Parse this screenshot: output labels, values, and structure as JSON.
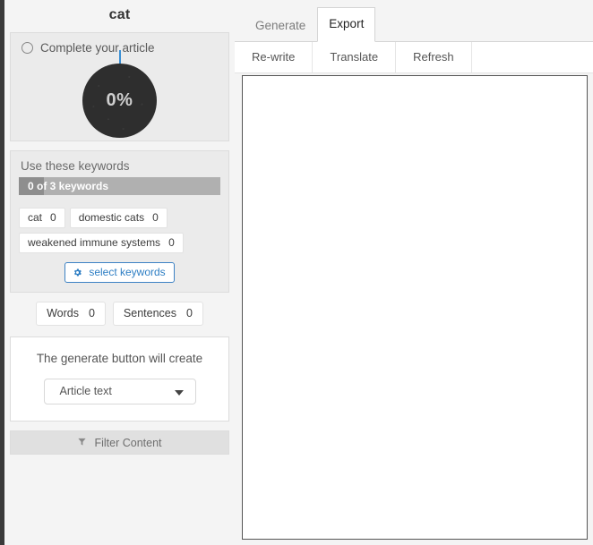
{
  "left": {
    "doc_title": "cat",
    "progress": {
      "status_label": "Complete your article",
      "percent_label": "0%",
      "percent_value": 0,
      "tick_color": "#3a8fd4",
      "donut_color": "#2e2e2e"
    },
    "keywords": {
      "heading": "Use these keywords",
      "progress_label": "0 of 3 keywords",
      "used": 0,
      "total": 3,
      "chips": [
        {
          "label": "cat",
          "count": "0"
        },
        {
          "label": "domestic cats",
          "count": "0"
        },
        {
          "label": "weakened immune systems",
          "count": "0"
        }
      ],
      "select_button": "select keywords",
      "select_button_icon": "gear-icon",
      "accent_color": "#2f7fc4"
    },
    "stats": [
      {
        "label": "Words",
        "value": "0"
      },
      {
        "label": "Sentences",
        "value": "0"
      }
    ],
    "generate": {
      "text": "The generate button will create",
      "selected_option": "Article text",
      "options": [
        "Article text"
      ],
      "caret_icon": "chevron-down-icon"
    },
    "filter": {
      "label": "Filter Content",
      "icon": "funnel-icon"
    }
  },
  "right": {
    "main_tabs": [
      {
        "label": "Generate",
        "active": false
      },
      {
        "label": "Export",
        "active": true
      }
    ],
    "sub_tabs": [
      {
        "label": "Re-write"
      },
      {
        "label": "Translate"
      },
      {
        "label": "Refresh"
      }
    ],
    "editor": {
      "value": "",
      "placeholder": ""
    }
  }
}
